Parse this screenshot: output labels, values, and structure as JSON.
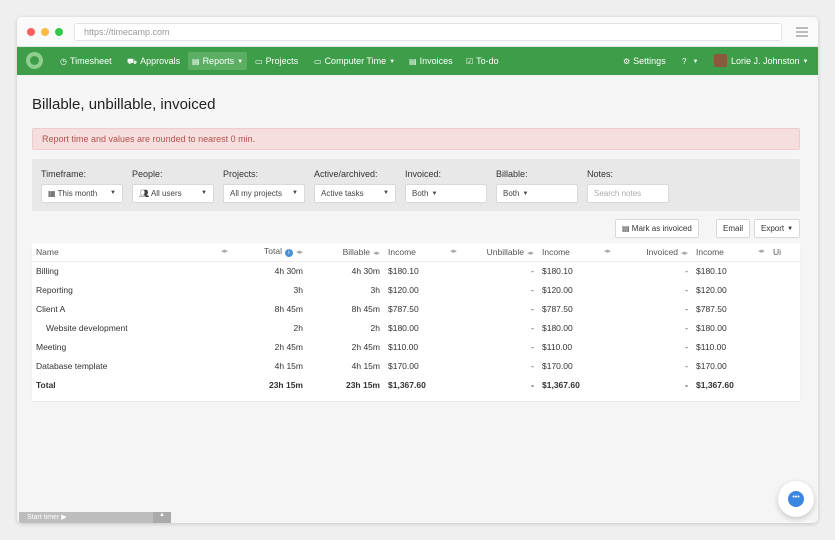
{
  "browser": {
    "url": "https://timecamp.com"
  },
  "nav": {
    "items": [
      {
        "label": "Timesheet",
        "icon": "clock-icon"
      },
      {
        "label": "Approvals",
        "icon": "car-icon"
      },
      {
        "label": "Reports",
        "icon": "document-icon",
        "active": true
      },
      {
        "label": "Projects",
        "icon": "folder-icon"
      },
      {
        "label": "Computer Time",
        "icon": "monitor-icon"
      },
      {
        "label": "Invoices",
        "icon": "invoice-icon"
      },
      {
        "label": "To-do",
        "icon": "checkbox-icon"
      }
    ],
    "settings_label": "Settings",
    "help_icon": "help-icon",
    "user_name": "Lorie J. Johnston",
    "accent": "#3d9d48"
  },
  "page": {
    "title": "Billable, unbillable, invoiced",
    "alert": "Report time and values are rounded to nearest 0 min."
  },
  "filters": {
    "timeframe": {
      "label": "Timeframe:",
      "value": "This month"
    },
    "people": {
      "label": "People:",
      "value": "All users"
    },
    "projects": {
      "label": "Projects:",
      "value": "All my projects"
    },
    "archived": {
      "label": "Active/archived:",
      "value": "Active tasks"
    },
    "invoiced": {
      "label": "Invoiced:",
      "value": "Both"
    },
    "billable": {
      "label": "Billable:",
      "value": "Both"
    },
    "notes": {
      "label": "Notes:",
      "placeholder": "Search notes"
    }
  },
  "actions": {
    "mark_invoiced": "Mark as invoiced",
    "email": "Email",
    "export": "Export"
  },
  "table": {
    "headers": [
      "Name",
      "Total",
      "Billable",
      "Income",
      "Unbillable",
      "Income",
      "Invoiced",
      "Income",
      "Ui"
    ],
    "rows": [
      {
        "name": "Billing",
        "total": "4h 30m",
        "billable": "4h 30m",
        "income1": "$180.10",
        "unbillable": "-",
        "income2": "$180.10",
        "invoiced": "-",
        "income3": "$180.10"
      },
      {
        "name": "Reporting",
        "total": "3h",
        "billable": "3h",
        "income1": "$120.00",
        "unbillable": "-",
        "income2": "$120.00",
        "invoiced": "-",
        "income3": "$120.00"
      },
      {
        "name": "Client A",
        "total": "8h 45m",
        "billable": "8h 45m",
        "income1": "$787.50",
        "unbillable": "-",
        "income2": "$787.50",
        "invoiced": "-",
        "income3": "$787.50"
      },
      {
        "name": "Website development",
        "total": "2h",
        "billable": "2h",
        "income1": "$180.00",
        "unbillable": "-",
        "income2": "$180.00",
        "invoiced": "-",
        "income3": "$180.00"
      },
      {
        "name": "Meeting",
        "total": "2h 45m",
        "billable": "2h 45m",
        "income1": "$110.00",
        "unbillable": "-",
        "income2": "$110.00",
        "invoiced": "-",
        "income3": "$110.00"
      },
      {
        "name": "Database template",
        "total": "4h 15m",
        "billable": "4h 15m",
        "income1": "$170.00",
        "unbillable": "-",
        "income2": "$170.00",
        "invoiced": "-",
        "income3": "$170.00"
      }
    ],
    "total": {
      "name": "Total",
      "total": "23h 15m",
      "billable": "23h 15m",
      "income1": "$1,367.60",
      "unbillable": "-",
      "income2": "$1,367.60",
      "invoiced": "-",
      "income3": "$1,367.60"
    }
  },
  "footer": {
    "start_timer": "Start timer"
  }
}
